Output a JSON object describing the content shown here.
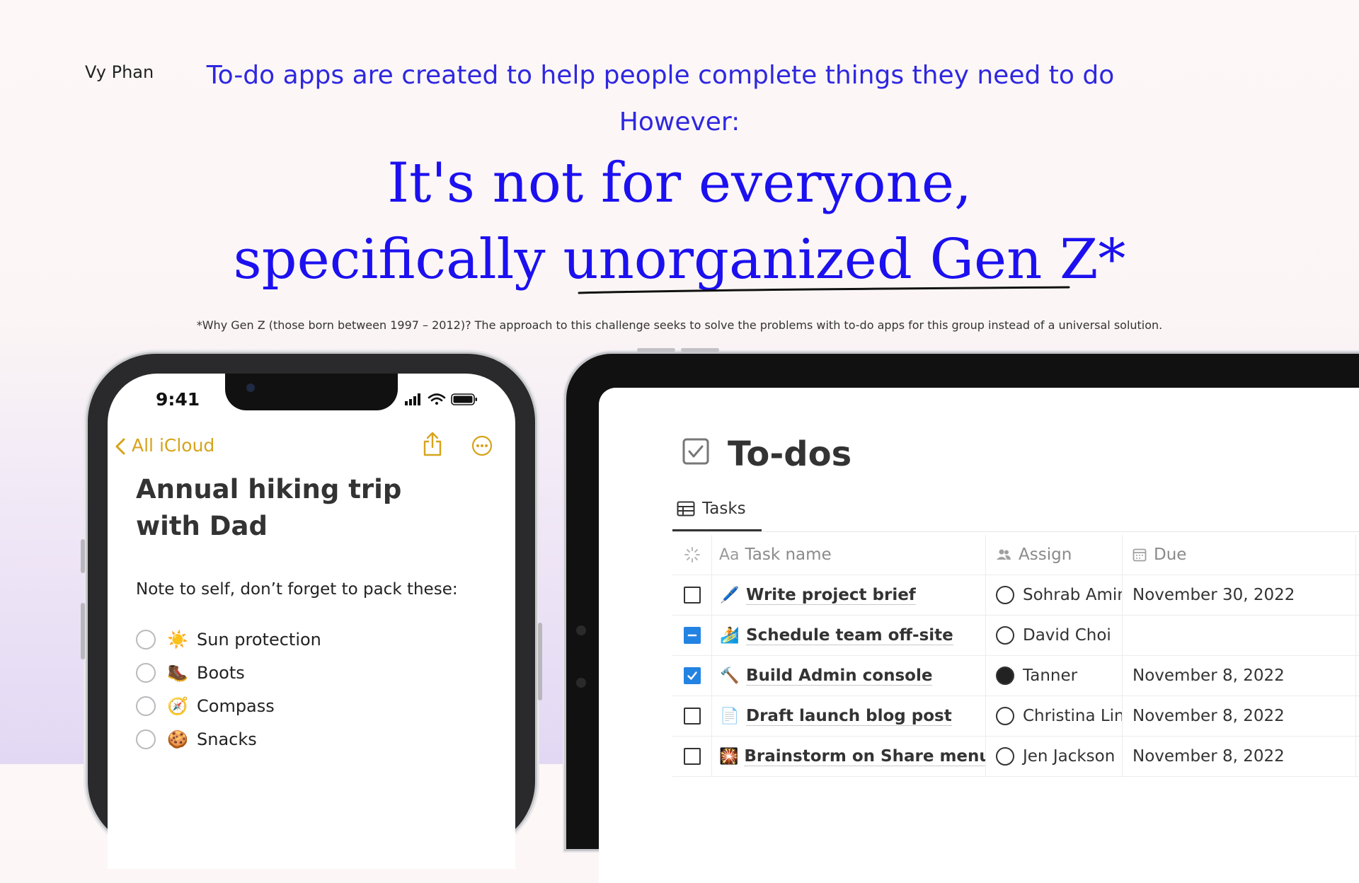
{
  "header": {
    "author": "Vy Phan",
    "intro": "To-do apps are created to help people complete things they need to do",
    "however": "However:",
    "headline_line1": "It's not for everyone,",
    "headline_line2": "specifically unorganized Gen Z*",
    "footnote": "*Why Gen Z (those born between 1997 – 2012)? The approach to this challenge seeks to solve the problems with to-do apps for this group instead of a universal solution."
  },
  "phone": {
    "status_time": "9:41",
    "back_label": "All iCloud",
    "accent_color": "#d6a31b",
    "note_title": "Annual hiking trip with Dad",
    "note_body": "Note to self, don’t forget to pack these:",
    "checklist": [
      {
        "emoji": "☀️",
        "icon": "sun-icon",
        "label": "Sun protection",
        "checked": false
      },
      {
        "emoji": "🥾",
        "icon": "boot-icon",
        "label": "Boots",
        "checked": false
      },
      {
        "emoji": "🧭",
        "icon": "compass-icon",
        "label": "Compass",
        "checked": false
      },
      {
        "emoji": "🍪",
        "icon": "cookie-icon",
        "label": "Snacks",
        "checked": false
      }
    ]
  },
  "tablet": {
    "page_title": "To-dos",
    "view_tab": "Tasks",
    "columns": {
      "name": "Task name",
      "assign": "Assign",
      "due": "Due",
      "name_prefix": "Aa"
    },
    "checkbox_color": "#2383e2",
    "rows": [
      {
        "status": "unchecked",
        "emoji": "🖊️",
        "icon": "pen-icon",
        "name": "Write project brief",
        "assignee": "Sohrab Amin",
        "due": "November 30, 2022"
      },
      {
        "status": "indeterminate",
        "emoji": "🏄",
        "icon": "surfer-icon",
        "name": "Schedule team off-site",
        "assignee": "David Choi",
        "due": ""
      },
      {
        "status": "checked",
        "emoji": "🔨",
        "icon": "hammer-icon",
        "name": "Build Admin console",
        "assignee": "Tanner",
        "due": "November 8, 2022"
      },
      {
        "status": "unchecked",
        "emoji": "📄",
        "icon": "document-icon",
        "name": "Draft launch blog post",
        "assignee": "Christina Lin",
        "due": "November 8, 2022"
      },
      {
        "status": "unchecked",
        "emoji": "🎇",
        "icon": "sparkler-icon",
        "name": "Brainstorm on Share menu",
        "assignee": "Jen Jackson",
        "due": "November 8, 2022"
      }
    ]
  },
  "colors": {
    "headline": "#1c10f0",
    "intro": "#2f27e0"
  }
}
